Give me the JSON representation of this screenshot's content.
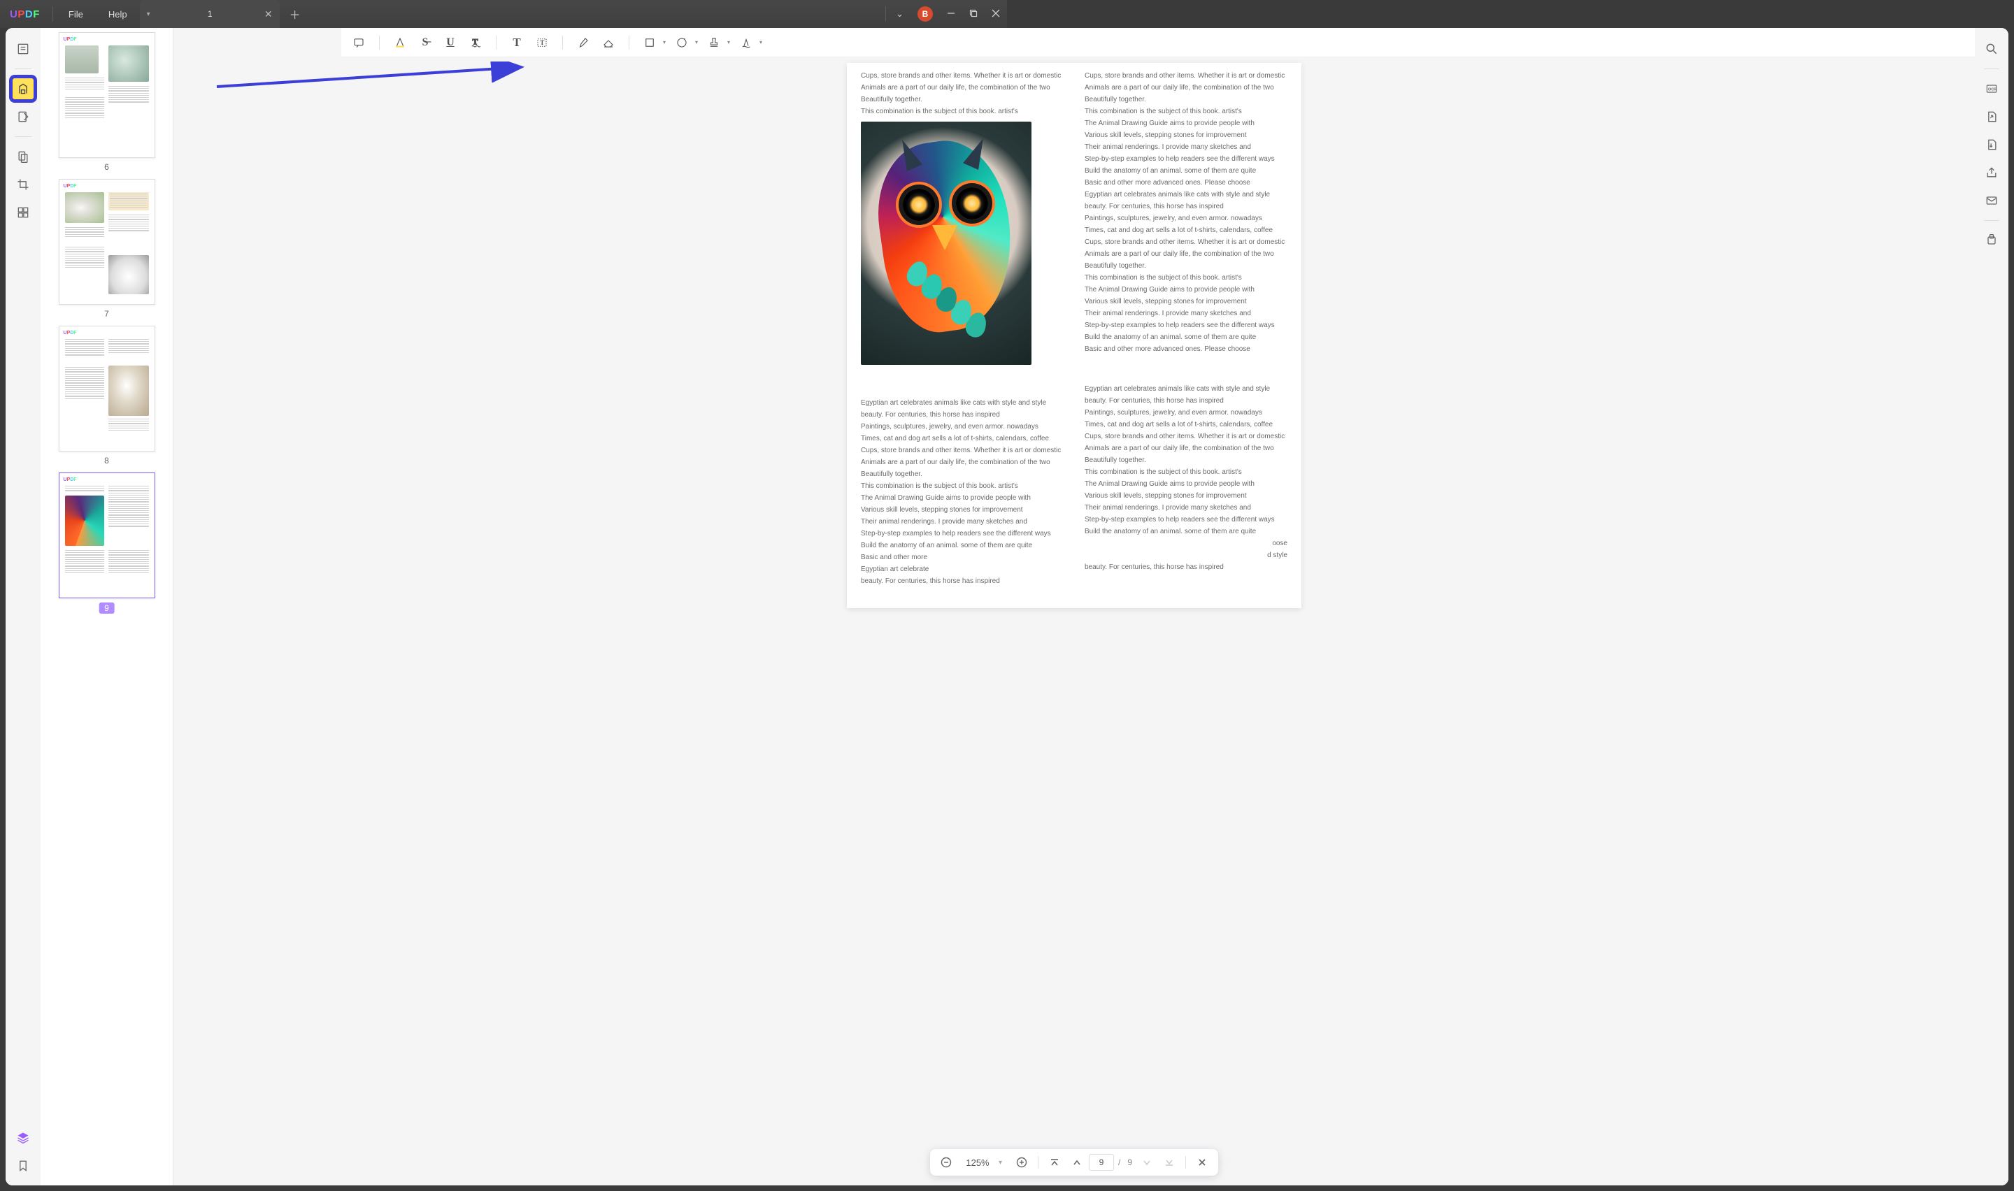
{
  "titlebar": {
    "logo": "UPDF",
    "file": "File",
    "help": "Help",
    "tab_title": "1",
    "avatar_letter": "B"
  },
  "thumbnails": [
    {
      "num": "6",
      "selected": false
    },
    {
      "num": "7",
      "selected": false
    },
    {
      "num": "8",
      "selected": false
    },
    {
      "num": "9",
      "selected": true
    }
  ],
  "toolbar": {
    "comment": "comment",
    "highlight": "highlight",
    "strike": "strike",
    "underline": "underline",
    "squiggly": "squiggly",
    "text": "text",
    "textbox": "textbox",
    "pencil": "pencil",
    "eraser": "eraser",
    "rect": "rect",
    "sticker": "sticker",
    "stamp": "stamp",
    "signature": "signature"
  },
  "page": {
    "col1": [
      "Cups, store brands and other items. Whether it is art or domestic",
      "Animals are a part of our daily life, the combination of the two",
      "Beautifully together.",
      "This combination is the subject of this book. artist's"
    ],
    "col2": [
      "Cups, store brands and other items. Whether it is art or domestic",
      "Animals are a part of our daily life, the combination of the two",
      "Beautifully together.",
      "This combination is the subject of this book. artist's",
      "The Animal Drawing Guide aims to provide people with",
      "Various skill levels, stepping stones for improvement",
      "Their animal renderings. I provide many sketches and",
      "Step-by-step examples to help readers see the different ways",
      "Build the anatomy of an animal. some of them are quite",
      "Basic and other more advanced ones. Please choose",
      "Egyptian art celebrates animals like cats with style and style",
      "beauty. For centuries, this horse has inspired",
      "Paintings, sculptures, jewelry, and even armor. nowadays",
      "Times, cat and dog art sells a lot of t-shirts, calendars, coffee",
      "Cups, store brands and other items. Whether it is art or domestic",
      "Animals are a part of our daily life, the combination of the two",
      "Beautifully together.",
      "This combination is the subject of this book. artist's",
      "The Animal Drawing Guide aims to provide people with",
      "Various skill levels, stepping stones for improvement",
      "Their animal renderings. I provide many sketches and",
      "Step-by-step examples to help readers see the different ways",
      "Build the anatomy of an animal. some of them are quite",
      "Basic and other more advanced ones. Please choose"
    ],
    "col1b": [
      "Egyptian art celebrates animals like cats with style and style",
      "beauty. For centuries, this horse has inspired",
      "Paintings, sculptures, jewelry, and even armor. nowadays",
      "Times, cat and dog art sells a lot of t-shirts, calendars, coffee",
      "Cups, store brands and other items. Whether it is art or domestic",
      "Animals are a part of our daily life, the combination of the two",
      "Beautifully together.",
      "This combination is the subject of this book. artist's",
      "The Animal Drawing Guide aims to provide people with",
      "Various skill levels, stepping stones for improvement",
      "Their animal renderings. I provide many sketches and",
      "Step-by-step examples to help readers see the different ways",
      "Build the anatomy of an animal. some of them are quite",
      "Basic and other more",
      "Egyptian art celebrate",
      "beauty. For centuries, this horse has inspired"
    ],
    "col2b": [
      "Egyptian art celebrates animals like cats with style and style",
      "beauty. For centuries, this horse has inspired",
      "Paintings, sculptures, jewelry, and even armor. nowadays",
      "Times, cat and dog art sells a lot of t-shirts, calendars, coffee",
      "Cups, store brands and other items. Whether it is art or domestic",
      "Animals are a part of our daily life, the combination of the two",
      "Beautifully together.",
      "This combination is the subject of this book. artist's",
      "The Animal Drawing Guide aims to provide people with",
      "Various skill levels, stepping stones for improvement",
      "Their animal renderings. I provide many sketches and",
      "Step-by-step examples to help readers see the different ways",
      "Build the anatomy of an animal. some of them are quite",
      "oose",
      "d style",
      "beauty. For centuries, this horse has inspired"
    ]
  },
  "pager": {
    "zoom": "125%",
    "page_current": "9",
    "page_sep": "/",
    "page_total": "9"
  }
}
